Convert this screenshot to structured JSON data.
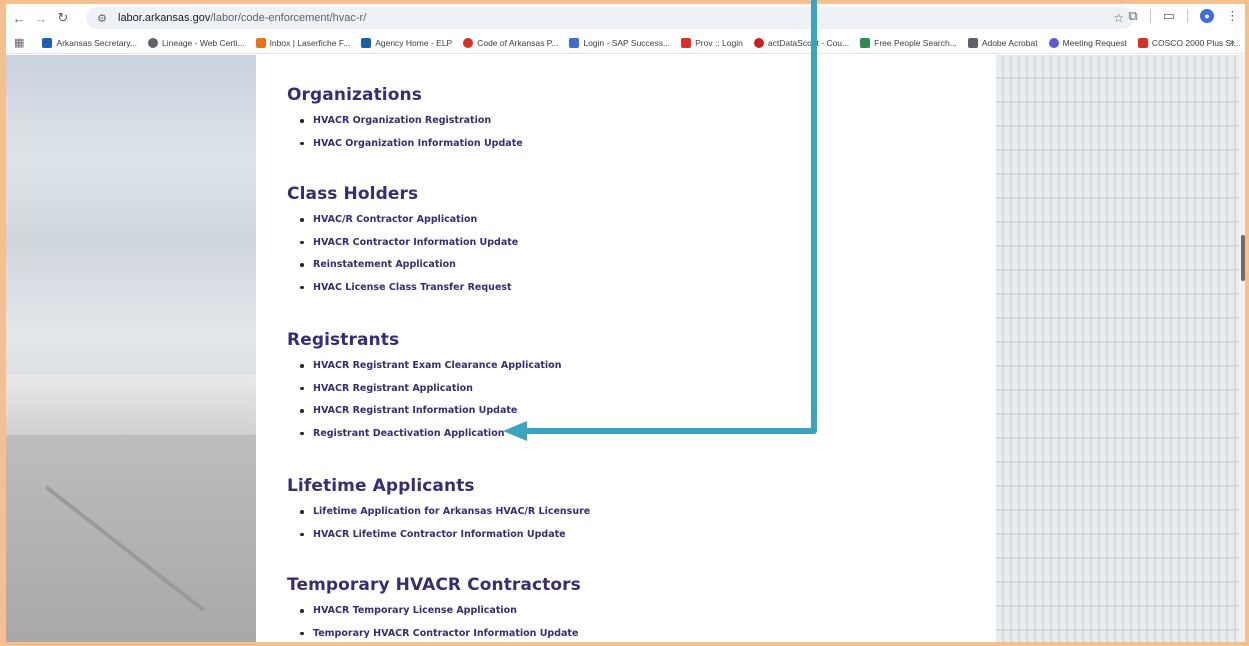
{
  "browser": {
    "url_host": "labor.arkansas.gov",
    "url_path": "/labor/code-enforcement/hvac-r/",
    "bookmarks": [
      {
        "label": "Arkansas Secretary...",
        "color": "#1f5fb6"
      },
      {
        "label": "Lineage - Web Certi...",
        "color": "#5f6368"
      },
      {
        "label": "Inbox | Laserfiche F...",
        "color": "#e8711a"
      },
      {
        "label": "Agency Home - ELP",
        "color": "#1a5ea8"
      },
      {
        "label": "Code of Arkansas P...",
        "color": "#d93025"
      },
      {
        "label": "Login - SAP Success...",
        "color": "#3b6fd4"
      },
      {
        "label": "Prov :: Login",
        "color": "#d93025"
      },
      {
        "label": "actDataScout - Cou...",
        "color": "#c5221f"
      },
      {
        "label": "Free People Search...",
        "color": "#2e8b57"
      },
      {
        "label": "Adobe Acrobat",
        "color": "#5f6368"
      },
      {
        "label": "Meeting Request",
        "color": "#5b5bd6"
      },
      {
        "label": "COSCO 2000 Plus St...",
        "color": "#d93025"
      }
    ],
    "more_label": "»"
  },
  "page": {
    "sections": [
      {
        "title": "Organizations",
        "items": [
          "HVACR Organization Registration",
          "HVAC Organization Information Update"
        ]
      },
      {
        "title": "Class Holders",
        "items": [
          "HVAC/R Contractor Application",
          "HVACR Contractor Information Update",
          "Reinstatement Application",
          "HVAC License Class Transfer Request"
        ]
      },
      {
        "title": "Registrants",
        "items": [
          "HVACR Registrant Exam Clearance Application",
          "HVACR Registrant Application",
          "HVACR Registrant Information Update",
          "Registrant Deactivation Application"
        ]
      },
      {
        "title": "Lifetime Applicants",
        "items": [
          "Lifetime Application for Arkansas HVAC/R Licensure",
          "HVACR Lifetime Contractor Information Update"
        ]
      },
      {
        "title": "Temporary HVACR Contractors",
        "items": [
          "HVACR Temporary License Application",
          "Temporary HVACR Contractor Information Update"
        ]
      }
    ]
  },
  "annotation": {
    "color": "#3aa3bf"
  }
}
